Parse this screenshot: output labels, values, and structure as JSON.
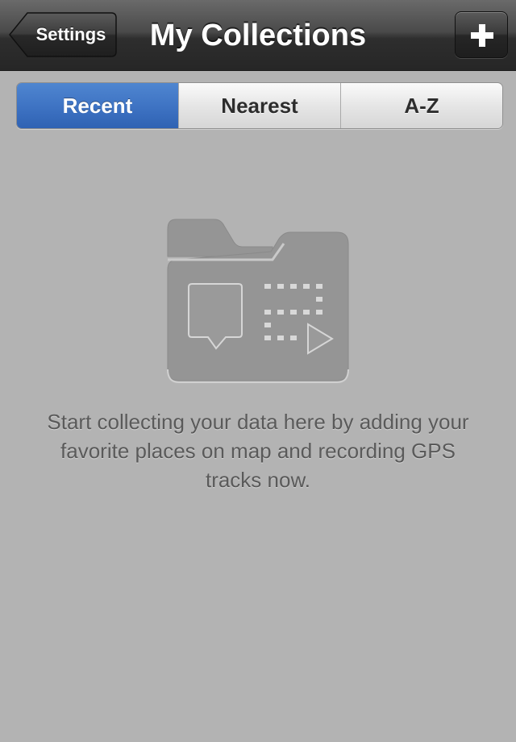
{
  "navbar": {
    "back_label": "Settings",
    "title": "My Collections",
    "add_icon": "plus-icon"
  },
  "segments": {
    "items": [
      {
        "label": "Recent",
        "selected": true
      },
      {
        "label": "Nearest",
        "selected": false
      },
      {
        "label": "A-Z",
        "selected": false
      }
    ]
  },
  "empty_state": {
    "icon": "folder-map-icon",
    "message": "Start collecting your data here by adding your favorite places on map and recording GPS tracks now."
  },
  "colors": {
    "accent": "#3f74c4",
    "background": "#b3b3b3",
    "navbar": "#3a3a3a"
  }
}
